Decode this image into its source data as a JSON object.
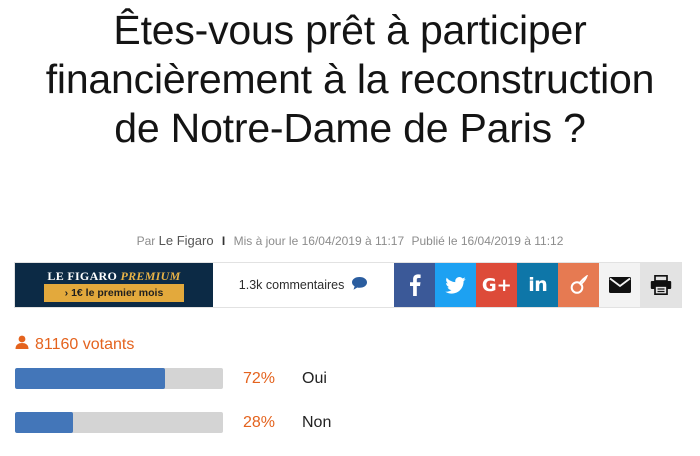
{
  "article": {
    "title": "Êtes-vous prêt à participer financièrement à la reconstruction de Notre-Dame de Paris ?",
    "byline_prefix": "Par",
    "author": "Le Figaro",
    "separator": "I",
    "updated": "Mis à jour le 16/04/2019 à 11:17",
    "published": "Publié le 16/04/2019 à 11:12"
  },
  "promo": {
    "brand": "LE FIGARO",
    "brand_premium": "PREMIUM",
    "cta": "›   1€ le premier mois"
  },
  "share": {
    "comments_label": "1.3k commentaires",
    "icons": [
      "comment-icon",
      "facebook-icon",
      "twitter-icon",
      "google-plus-icon",
      "linkedin-icon",
      "viadeo-icon",
      "mail-icon",
      "print-icon"
    ],
    "google_label": "G+",
    "linkedin_label": "in"
  },
  "poll": {
    "voters": "81160 votants",
    "options": [
      {
        "percent": 72,
        "percent_label": "72%",
        "label": "Oui"
      },
      {
        "percent": 28,
        "percent_label": "28%",
        "label": "Non"
      }
    ]
  },
  "colors": {
    "accent_orange": "#e4631e",
    "bar_blue": "#4376b9",
    "bar_track": "#d4d4d4",
    "facebook": "#3b5998",
    "twitter": "#1da1f2",
    "google_plus": "#dd4b39",
    "linkedin": "#0e76a8",
    "promo_navy": "#0c2a45",
    "promo_gold": "#e3a93c"
  }
}
